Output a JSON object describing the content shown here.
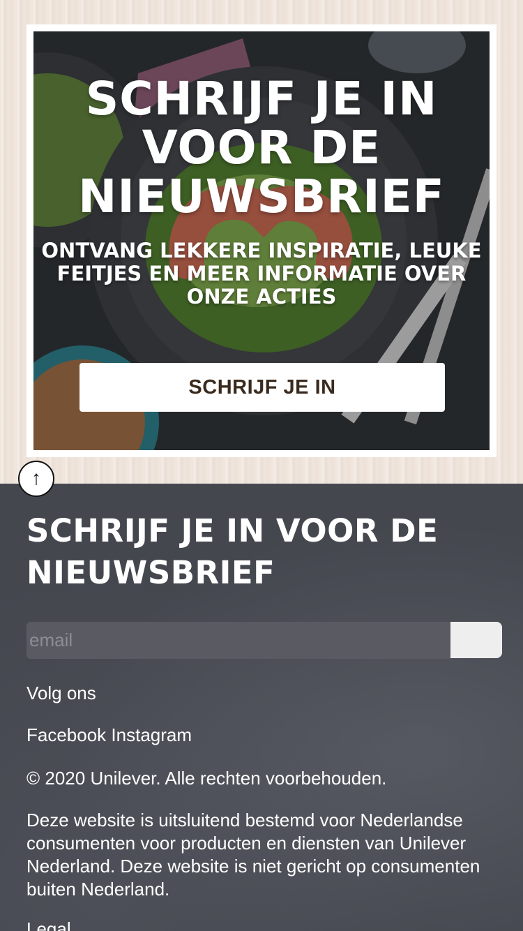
{
  "promo": {
    "title": "SCHRIJF JE IN VOOR DE NIEUWSBRIEF",
    "subtitle": "ONTVANG LEKKERE INSPIRATIE, LEUKE FEITJES EN MEER INFORMATIE OVER ONZE ACTIES",
    "button_label": "SCHRIJF JE IN"
  },
  "back_to_top": {
    "icon": "arrow-up-icon",
    "glyph": "↑"
  },
  "footer": {
    "title": "SCHRIJF JE IN VOOR DE NIEUWSBRIEF",
    "email_placeholder": "email",
    "email_value": "",
    "follow_label": "Volg ons",
    "social": [
      "Facebook",
      "Instagram"
    ],
    "copyright": "© 2020 Unilever. Alle rechten voorbehouden.",
    "disclaimer": "Deze website is uitsluitend bestemd voor Nederlandse consumenten voor producten en diensten van Unilever Nederland. Deze website is niet gericht op consumenten buiten Nederland.",
    "legal_partial": "Legal"
  },
  "colors": {
    "footer_bg": "#45474f",
    "input_bg": "#5a5a63",
    "button_text": "#3a2a1e"
  }
}
